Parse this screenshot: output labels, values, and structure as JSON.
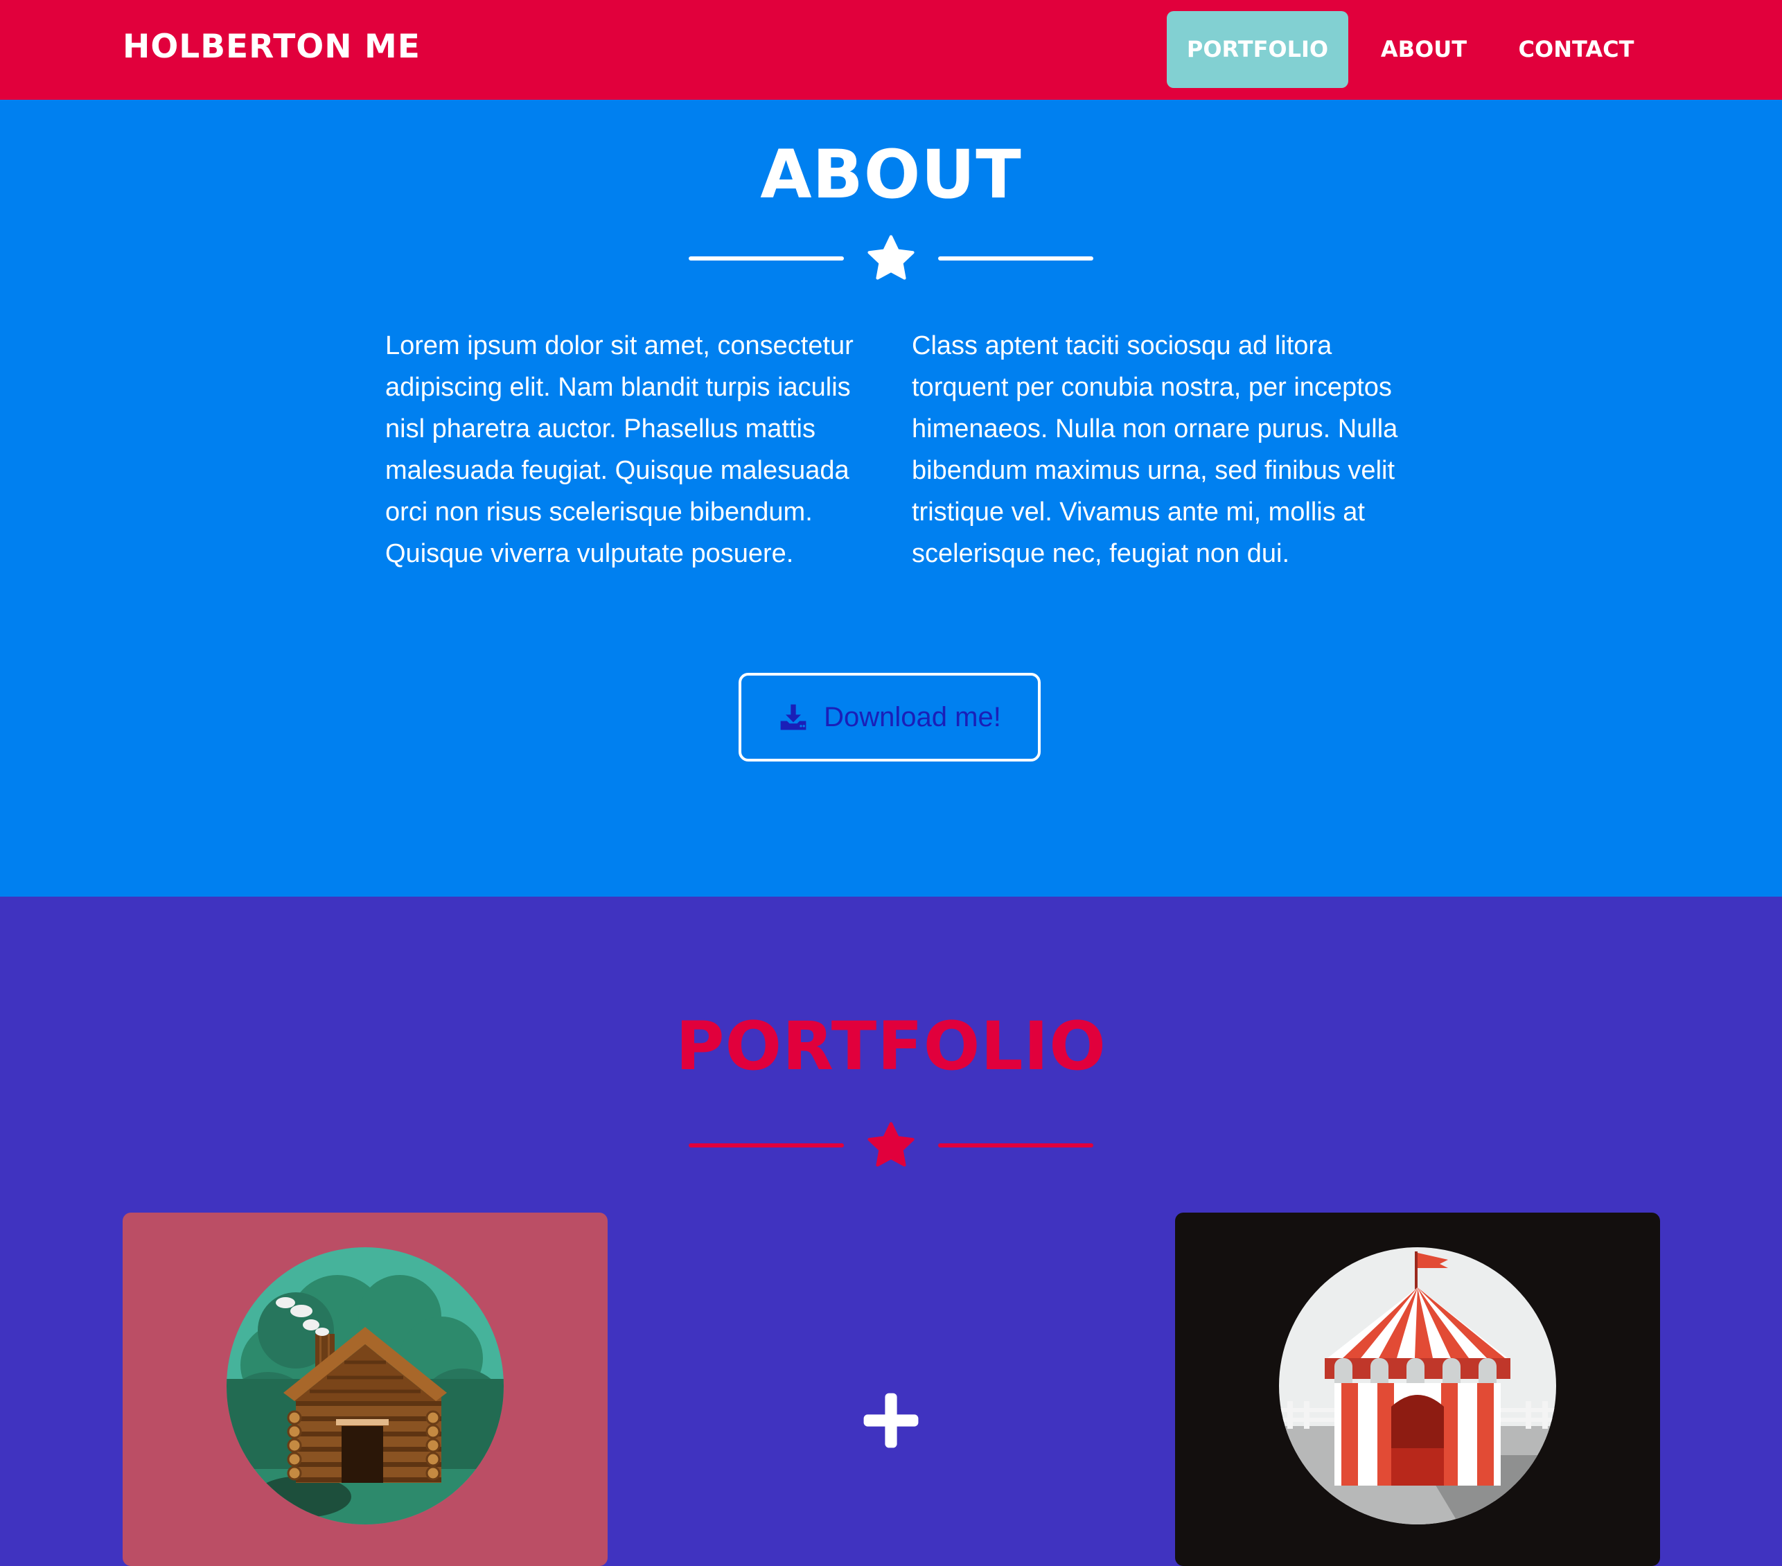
{
  "navbar": {
    "brand": "HOLBERTON ME",
    "links": [
      "PORTFOLIO",
      "ABOUT",
      "CONTACT"
    ],
    "active_link": "PORTFOLIO"
  },
  "about": {
    "title": "ABOUT",
    "divider_icon": "star-icon",
    "col1": "Lorem ipsum dolor sit amet, consectetur adipiscing elit. Nam blandit turpis iaculis nisl pharetra auctor. Phasellus mattis malesuada feugiat. Quisque malesuada orci non risus scelerisque bibendum. Quisque viverra vulputate posuere.",
    "col2": "Class aptent taciti sociosqu ad litora torquent per conubia nostra, per inceptos himenaeos. Nulla non ornare purus. Nulla bibendum maximus urna, sed finibus velit tristique vel. Vivamus ante mi, mollis at scelerisque nec, feugiat non dui.",
    "download_label": "Download me!",
    "download_icon": "download-icon"
  },
  "portfolio": {
    "title": "PORTFOLIO",
    "divider_icon": "star-icon",
    "hover_icon": "plus-icon",
    "items": [
      {
        "illustration": "cabin-illustration"
      },
      {
        "illustration": "circus-tent-illustration"
      }
    ]
  },
  "colors": {
    "navbar_bg": "#e1003c",
    "nav_active_bg": "#82d0d2",
    "about_bg": "#0080f0",
    "portfolio_bg": "#4033c0",
    "portfolio_accent": "#e1003c",
    "download_text": "#1a1fb8",
    "card_cabin_bg": "#bb4e65",
    "card_circus_bg": "#130f0e"
  }
}
